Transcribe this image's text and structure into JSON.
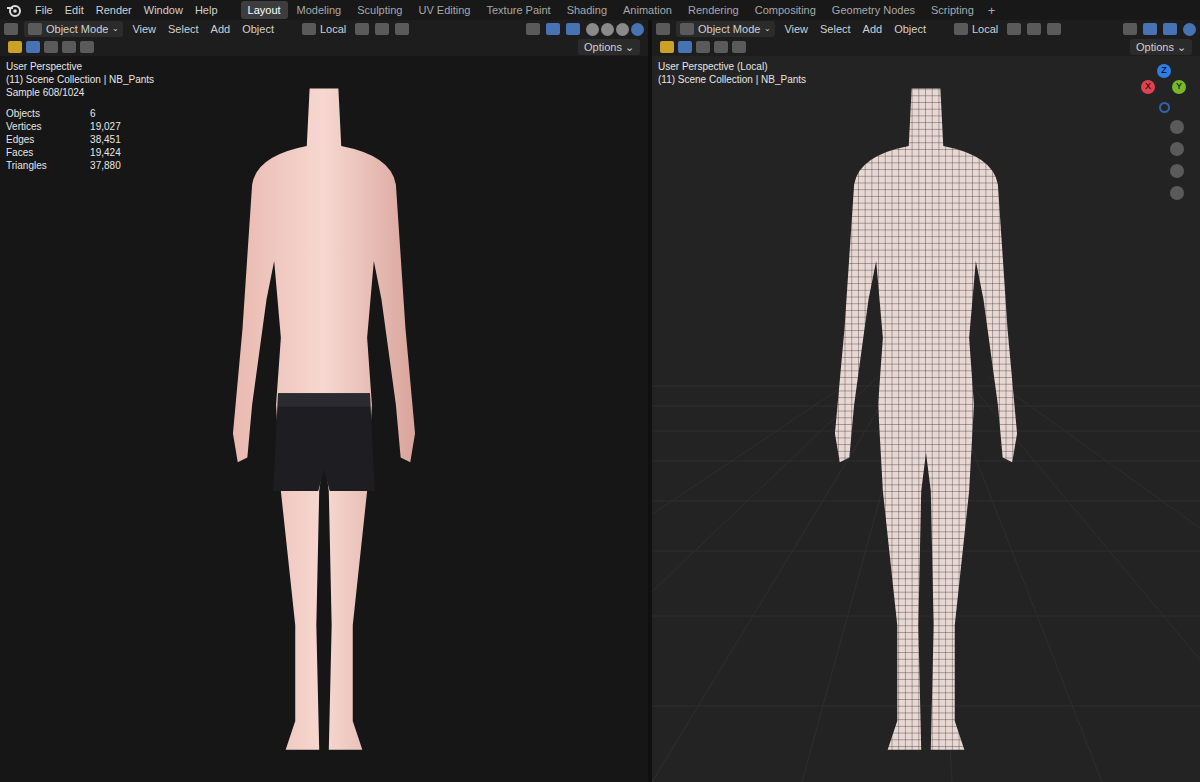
{
  "topbar": {
    "menus": [
      "File",
      "Edit",
      "Render",
      "Window",
      "Help"
    ],
    "workspaces": [
      {
        "label": "Layout",
        "selected": true
      },
      {
        "label": "Modeling",
        "selected": false
      },
      {
        "label": "Sculpting",
        "selected": false
      },
      {
        "label": "UV Editing",
        "selected": false
      },
      {
        "label": "Texture Paint",
        "selected": false
      },
      {
        "label": "Shading",
        "selected": false
      },
      {
        "label": "Animation",
        "selected": false
      },
      {
        "label": "Rendering",
        "selected": false
      },
      {
        "label": "Compositing",
        "selected": false
      },
      {
        "label": "Geometry Nodes",
        "selected": false
      },
      {
        "label": "Scripting",
        "selected": false
      }
    ],
    "add_workspace": "+"
  },
  "editors": [
    {
      "name": "left",
      "mode": "Object Mode",
      "menus": [
        "View",
        "Select",
        "Add",
        "Object"
      ],
      "orientation": "Local",
      "options": "Options",
      "kind": "rendered",
      "overlay": [
        "User Perspective",
        "(11) Scene Collection | NB_Pants",
        "Sample 608/1024"
      ],
      "stats": [
        {
          "label": "Objects",
          "value": "6"
        },
        {
          "label": "Vertices",
          "value": "19,027"
        },
        {
          "label": "Edges",
          "value": "38,451"
        },
        {
          "label": "Faces",
          "value": "19,424"
        },
        {
          "label": "Triangles",
          "value": "37,880"
        }
      ],
      "shading": [
        {
          "selected": false
        },
        {
          "selected": false
        },
        {
          "selected": false
        },
        {
          "selected": true
        }
      ],
      "gizmo": null
    },
    {
      "name": "right",
      "mode": "Object Mode",
      "menus": [
        "View",
        "Select",
        "Add",
        "Object"
      ],
      "orientation": "Local",
      "options": "Options",
      "kind": "wireframe",
      "overlay": [
        "User Perspective (Local)",
        "(11) Scene Collection | NB_Pants"
      ],
      "stats": [],
      "shading": [
        {
          "selected": true
        }
      ],
      "gizmo": {
        "axes": [
          {
            "label": "Z",
            "color": "#2f7de1"
          },
          {
            "label": "X",
            "color": "#e0414f"
          },
          {
            "label": "Y",
            "color": "#76b82a"
          }
        ]
      }
    }
  ]
}
